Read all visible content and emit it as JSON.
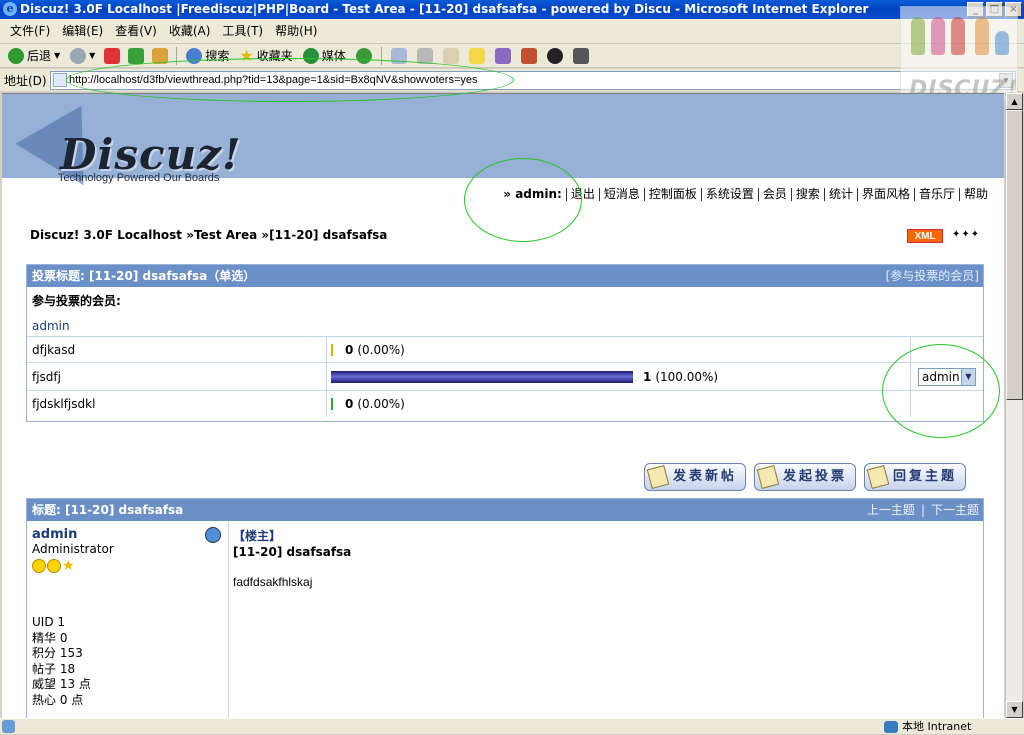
{
  "window": {
    "title": "Discuz! 3.0F Localhost |Freediscuz|PHP|Board - Test Area - [11-20] dsafsafsa - powered by Discu - Microsoft Internet Explorer",
    "buttons": [
      "_",
      "□",
      "×"
    ]
  },
  "menu": [
    "文件(F)",
    "编辑(E)",
    "查看(V)",
    "收藏(A)",
    "工具(T)",
    "帮助(H)"
  ],
  "toolbar": {
    "back": "后退",
    "search": "搜索",
    "favorites": "收藏夹",
    "media": "媒体"
  },
  "address": {
    "label": "地址(D)",
    "url": "http://localhost/d3fb/viewthread.php?tid=13&page=1&sid=Bx8qNV&showvoters=yes"
  },
  "watermark": "DISCUZ!",
  "logo": {
    "word": "Discuz!",
    "tagline": "Technology Powered Our Boards"
  },
  "nav": {
    "user": "» admin:",
    "items": [
      "退出",
      "短消息",
      "控制面板",
      "系统设置",
      "会员",
      "搜索",
      "统计",
      "界面风格",
      "音乐厅",
      "帮助"
    ]
  },
  "breadcrumb": {
    "parts": [
      "Discuz! 3.0F Localhost",
      " »Test Area »",
      "[11-20] dsafsafsa"
    ]
  },
  "xml_badge": "XML",
  "nav_arrows": "✦✦✦",
  "poll": {
    "title": "投票标题: [11-20] dsafsafsa（单选）",
    "voters_link": "[参与投票的会员]",
    "voters_label": "参与投票的会员:",
    "voters": [
      "admin"
    ],
    "options": [
      {
        "label": "dfjkasd",
        "count": "0",
        "percent": "(0.00%)",
        "fraction": 0
      },
      {
        "label": "fjsdfj",
        "count": "1",
        "percent": "(100.00%)",
        "fraction": 1
      },
      {
        "label": "fjdsklfjsdkl",
        "count": "0",
        "percent": "(0.00%)",
        "fraction": 0
      }
    ],
    "select_value": "admin"
  },
  "actions": [
    "发表新帖",
    "发起投票",
    "回复主题"
  ],
  "post": {
    "header": "标题: [11-20] dsafsafsa",
    "prev": "上一主题",
    "next": "下一主题",
    "author": "admin",
    "group": "Administrator",
    "floor": "【楼主】",
    "title": "[11-20] dsafsafsa",
    "content": "fadfdsakfhlskaj",
    "stats": [
      "UID  1",
      "精华  0",
      "积分  153",
      "帖子  18",
      "威望  13 点",
      "热心  0 点"
    ]
  },
  "status": {
    "zone": "本地 Intranet"
  }
}
